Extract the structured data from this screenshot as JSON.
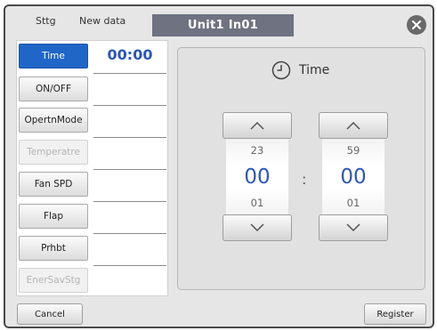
{
  "header": {
    "settings_label": "Sttg",
    "new_data_label": "New data",
    "unit_title": "Unit1 In01"
  },
  "menu": [
    {
      "label": "Time",
      "state": "active"
    },
    {
      "label": "ON/OFF",
      "state": "normal"
    },
    {
      "label": "OpertnMode",
      "state": "normal"
    },
    {
      "label": "Temperatre",
      "state": "disabled"
    },
    {
      "label": "Fan SPD",
      "state": "normal"
    },
    {
      "label": "Flap",
      "state": "normal"
    },
    {
      "label": "Prhbt",
      "state": "normal"
    },
    {
      "label": "EnerSavStg",
      "state": "disabled"
    }
  ],
  "values": [
    "00:00",
    "",
    "",
    "",
    "",
    "",
    "",
    ""
  ],
  "time_panel": {
    "title": "Time",
    "hour": {
      "prev": "23",
      "current": "00",
      "next": "01"
    },
    "separator": ":",
    "minute": {
      "prev": "59",
      "current": "00",
      "next": "01"
    }
  },
  "footer": {
    "cancel_label": "Cancel",
    "register_label": "Register"
  },
  "colors": {
    "active_blue": "#1f66c7",
    "value_blue": "#2c56b4",
    "title_bar": "#6f7280"
  }
}
